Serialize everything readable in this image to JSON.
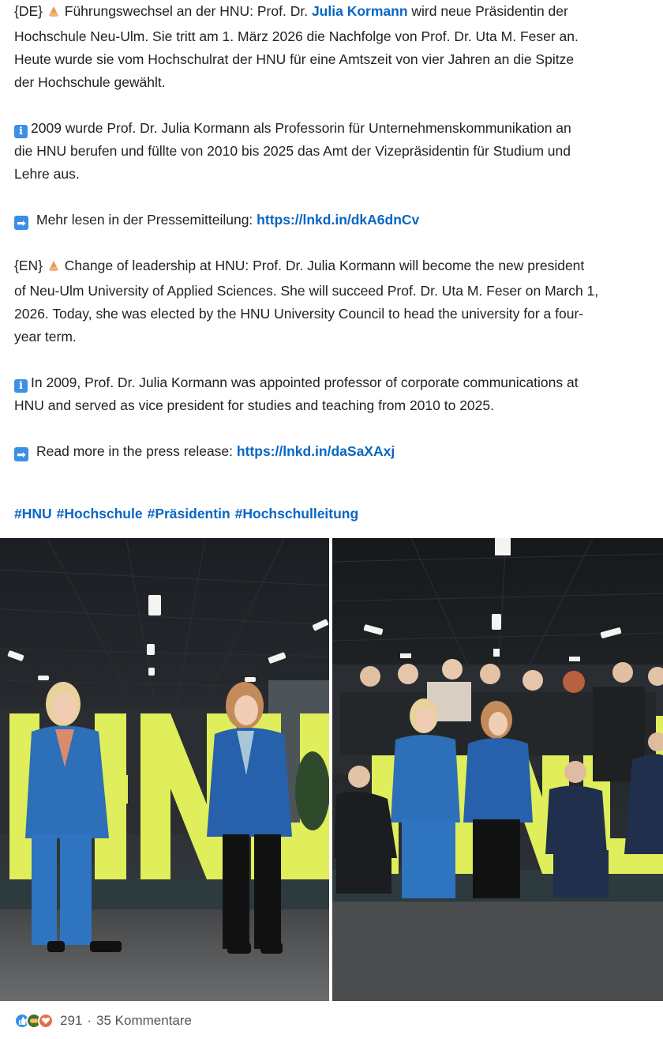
{
  "post": {
    "de_intro": {
      "tag": "{DE}",
      "before_mention": "Führungswechsel an der HNU: Prof. Dr.",
      "mention": "Julia Kormann",
      "after_mention_line1": "wird neue Präsidentin der",
      "line2": "Hochschule Neu-Ulm. Sie tritt am 1. März 2026 die Nachfolge von Prof. Dr. Uta M. Feser an.",
      "line3": "Heute wurde sie vom Hochschulrat der HNU für eine Amtszeit von vier Jahren an die Spitze",
      "line4": "der Hochschule gewählt."
    },
    "de_info": {
      "line1": "2009 wurde Prof. Dr. Julia Kormann als Professorin für Unternehmenskommunikation an",
      "line2": "die HNU berufen und füllte von 2010 bis 2025 das Amt der Vizepräsidentin für Studium und",
      "line3": "Lehre aus."
    },
    "de_more": {
      "text": "Mehr lesen in der Pressemitteilung:",
      "link": "https://lnkd.in/dkA6dnCv"
    },
    "en_intro": {
      "tag": "{EN}",
      "line1": "Change of leadership at HNU: Prof. Dr. Julia Kormann will become the new president",
      "line2": "of Neu-Ulm University of Applied Sciences. She will succeed Prof. Dr. Uta M. Feser on March 1,",
      "line3": "2026. Today, she was elected by the HNU University Council to head the university for a four-",
      "line4": "year term."
    },
    "en_info": {
      "line1": "In 2009, Prof. Dr. Julia Kormann was appointed professor of corporate communications at",
      "line2": "HNU and served as vice president for studies and teaching from 2010 to 2025."
    },
    "en_more": {
      "text": "Read more in the press release:",
      "link": "https://lnkd.in/daSaXAxj"
    },
    "hashtags": [
      "#HNU",
      "#Hochschule",
      "#Präsidentin",
      "#Hochschulleitung"
    ]
  },
  "photos": {
    "left": {
      "sign_text": "HNU"
    },
    "right": {
      "sign_text": "HNU"
    }
  },
  "social": {
    "count": "291",
    "separator": "·",
    "comments": "35 Kommentare"
  },
  "colors": {
    "link": "#0a66c2",
    "sign": "#dfee5a",
    "blue_suit": "#2d6fb8"
  },
  "icons": {
    "hand": "pointing-hand-icon",
    "info": "info-icon",
    "arrow": "right-arrow-icon",
    "like": "like-reaction-icon",
    "celebrate": "celebrate-reaction-icon",
    "love": "love-reaction-icon"
  }
}
